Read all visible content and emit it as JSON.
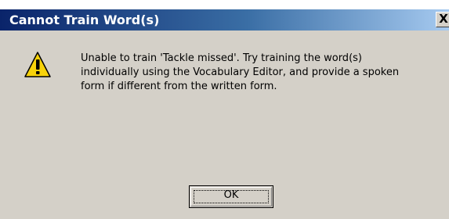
{
  "dialog": {
    "title": "Cannot Train Word(s)",
    "close_label": "X",
    "icon": "warning-icon",
    "message_lines": [
      "Unable to train 'Tackle missed'. Try training the word(s)",
      "individually using the Vocabulary Editor, and provide a spoken",
      "form if different from the written form."
    ],
    "ok_label": "OK"
  },
  "colors": {
    "title_gradient_start": "#0a246a",
    "title_gradient_end": "#a6caf0",
    "dialog_face": "#d4d0c8",
    "warning_yellow": "#f7d20a"
  }
}
